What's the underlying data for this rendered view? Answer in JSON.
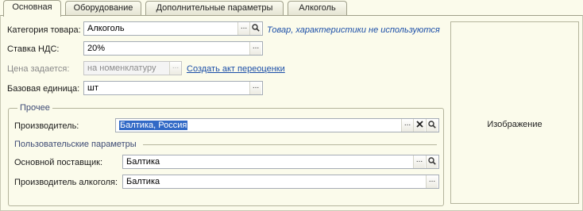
{
  "tabs": [
    {
      "label": "Основная",
      "active": true
    },
    {
      "label": "Оборудование",
      "active": false
    },
    {
      "label": "Дополнительные параметры",
      "active": false
    },
    {
      "label": "Алкоголь",
      "active": false
    }
  ],
  "form": {
    "category": {
      "label": "Категория товара:",
      "value": "Алкоголь"
    },
    "category_hint": "Товар, характеристики не используются",
    "vat": {
      "label": "Ставка НДС:",
      "value": "20%"
    },
    "price": {
      "label": "Цена задается:",
      "value": "на номенклатуру",
      "disabled": true
    },
    "revaluation_link": "Создать акт переоценки",
    "base_unit": {
      "label": "Базовая единица:",
      "value": "шт"
    }
  },
  "other_group": {
    "title": "Прочее",
    "manufacturer": {
      "label": "Производитель:",
      "value": "Балтика, Россия"
    },
    "custom_params_title": "Пользовательские параметры",
    "main_supplier": {
      "label": "Основной поставщик:",
      "value": "Балтика"
    },
    "alcohol_producer": {
      "label": "Производитель алкоголя:",
      "value": "Балтика"
    }
  },
  "image_panel": {
    "label": "Изображение"
  },
  "buttons": {
    "ellipsis": "...",
    "clear": "✕"
  },
  "icons": [
    "search-icon",
    "clear-icon"
  ],
  "colors": {
    "background": "#fbfbeb",
    "link": "#1c4fa8",
    "selection": "#3169c6"
  }
}
